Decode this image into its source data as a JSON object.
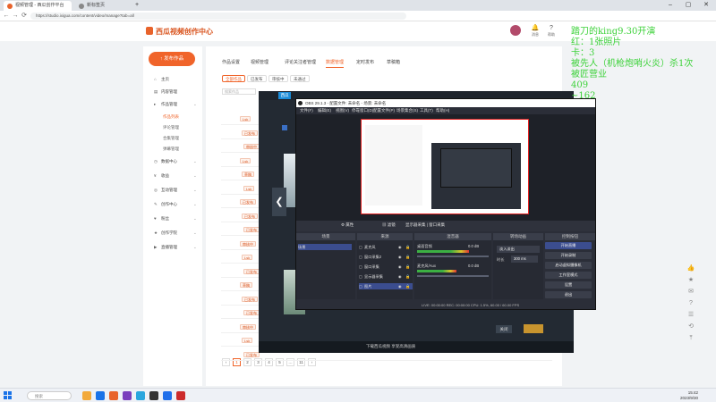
{
  "browser": {
    "tabs": [
      {
        "label": "视频管理 - 西瓜创作平台",
        "color": "#e8632b"
      },
      {
        "label": "新标签页",
        "color": "#888888"
      }
    ],
    "url": "https://studio.ixigua.com/content/video/manage?tab=all",
    "nav": {
      "back": "←",
      "forward": "→",
      "refresh": "⟳",
      "new_tab": "+"
    },
    "window": {
      "min": "–",
      "max": "▢",
      "close": "✕"
    }
  },
  "site": {
    "logo_text": "西瓜视频创作中心",
    "header_icons": [
      {
        "icon": "bell-icon",
        "glyph": "🔔",
        "label": "消息"
      },
      {
        "icon": "help-icon",
        "glyph": "?",
        "label": "帮助"
      }
    ]
  },
  "sidebar": {
    "publish_button": "↑ 发布作品",
    "items": [
      {
        "label": "主页",
        "glyph": "⌂",
        "sub": false,
        "on": false
      },
      {
        "label": "内容管理",
        "glyph": "▤",
        "sub": false,
        "on": false
      },
      {
        "label": "作品管理",
        "glyph": "▸",
        "sub": false,
        "on": false
      },
      {
        "label": "作品列表",
        "glyph": "",
        "sub": true,
        "on": true
      },
      {
        "label": "评论管理",
        "glyph": "",
        "sub": true,
        "on": false
      },
      {
        "label": "合集管理",
        "glyph": "",
        "sub": true,
        "on": false
      },
      {
        "label": "弹幕管理",
        "glyph": "",
        "sub": true,
        "on": false
      },
      {
        "label": "数据中心",
        "glyph": "◷",
        "sub": false,
        "on": false
      },
      {
        "label": "收益",
        "glyph": "¥",
        "sub": false,
        "on": false
      },
      {
        "label": "互动管理",
        "glyph": "◎",
        "sub": false,
        "on": false
      },
      {
        "label": "创作中心",
        "glyph": "✎",
        "sub": false,
        "on": false
      },
      {
        "label": "粉丝",
        "glyph": "♥",
        "sub": false,
        "on": false
      },
      {
        "label": "创作学院",
        "glyph": "★",
        "sub": false,
        "on": false
      },
      {
        "label": "直播管理",
        "glyph": "▶",
        "sub": false,
        "on": false
      }
    ]
  },
  "main": {
    "tabs": [
      "作品设置",
      "视频管理",
      "评论关注者管理",
      "数据管理",
      "定时发布",
      "草稿箱"
    ],
    "active_tab": 3,
    "subtabs": [
      "全部作品",
      "已发布",
      "审核中",
      "未通过"
    ],
    "search_placeholder": "搜索作品",
    "row_tags": [
      "Lsk",
      "已发布",
      "审核中",
      "Lsk",
      "草稿",
      "Lsk",
      "已发布",
      "已发布",
      "已发布",
      "审核中",
      "Lsk",
      "已发布",
      "草稿",
      "已发布",
      "已发布",
      "审核中",
      "Lsk",
      "已发布"
    ],
    "pager": [
      "‹",
      "1",
      "2",
      "3",
      "4",
      "5",
      "…",
      "11",
      "›"
    ]
  },
  "video_window": {
    "logo": "西瓜",
    "prev_arrow": "❮",
    "bottom_text": "下载西瓜视频 享受高清画质",
    "close_button": "关闭"
  },
  "obs": {
    "title": "OBS 29.1.3 - 配置文件: 未命名 - 场景: 未命名",
    "menu": [
      "文件(F)",
      "编辑(E)",
      "视图(V)",
      "停靠窗口(D)",
      "配置文件(P)",
      "场景集合(S)",
      "工具(T)",
      "帮助(H)"
    ],
    "controls": [
      "⚙ 属性",
      "▦ 滤镜",
      "显示器采集 | 窗口采集"
    ],
    "dock_headers": [
      "场景",
      "来源",
      "混音器",
      "转场动画",
      "控制按钮"
    ],
    "scenes": [
      "场景"
    ],
    "sources": [
      "麦克风",
      "窗口采集2",
      "窗口采集",
      "显示器采集",
      "图片"
    ],
    "mixer": [
      {
        "name": "桌面音频",
        "db": "0.0 dB",
        "level": 0.72
      },
      {
        "name": "麦克风/Aux",
        "db": "0.0 dB",
        "level": 0.55
      }
    ],
    "transition": {
      "type": "淡入淡出",
      "duration_label": "时长",
      "duration": "300 ms"
    },
    "control_buttons": [
      "开始直播",
      "开始录制",
      "启动虚拟摄像机",
      "工作室模式",
      "设置",
      "退出"
    ],
    "status": "LIVE: 00:00:00   REC: 00:00:00   CPU: 1.5%, 60.00 / 60.00 FPS"
  },
  "overlay_lines": [
    "踏刀的king9.30开演",
    "红：1张照片",
    "卡：3",
    "被先人（机枪炮哨火炎）杀1次",
    "被匠营业",
    "409",
    "~162"
  ],
  "right_rail": [
    "👍",
    "★",
    "✉",
    "?",
    "☰",
    "⟲",
    "⤒"
  ],
  "taskbar": {
    "search_placeholder": "搜索",
    "apps": [
      "#f2a93b",
      "#1a73e8",
      "#e8632b",
      "#7a3fbd",
      "#2aa6de",
      "#333333",
      "#1f6feb",
      "#cc2b2b"
    ],
    "clock": [
      "15:42",
      "2023/9/30"
    ]
  }
}
